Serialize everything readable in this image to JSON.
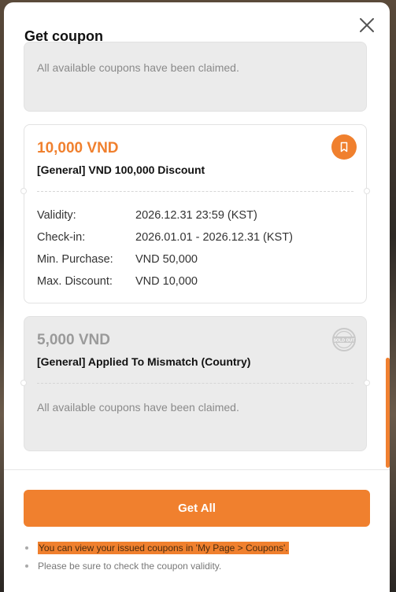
{
  "modal": {
    "title": "Get coupon",
    "close_icon": "close-icon"
  },
  "cards": {
    "top_partial": {
      "claimed_text": "All available coupons have been claimed."
    },
    "coupon1": {
      "price": "10,000 VND",
      "name": "[General] VND 100,000 Discount",
      "icon": "bookmark-icon",
      "rows": [
        {
          "k": "Validity:",
          "v": "2026.12.31 23:59 (KST)"
        },
        {
          "k": "Check-in:",
          "v": "2026.01.01 - 2026.12.31 (KST)"
        },
        {
          "k": "Min. Purchase:",
          "v": "VND 50,000"
        },
        {
          "k": "Max. Discount:",
          "v": "VND 10,000"
        }
      ]
    },
    "coupon2": {
      "price": "5,000 VND",
      "name": "[General] Applied To Mismatch (Country)",
      "icon": "sold-out-stamp-icon",
      "soldout_label": "SOLD OUT",
      "claimed_text": "All available coupons have been claimed."
    }
  },
  "footer": {
    "get_all_label": "Get All",
    "notes": [
      "You can view your issued coupons in 'My Page > Coupons'.",
      "Please be sure to check the coupon validity."
    ]
  },
  "colors": {
    "accent": "#f0802e",
    "card_grey": "#ebebeb"
  }
}
